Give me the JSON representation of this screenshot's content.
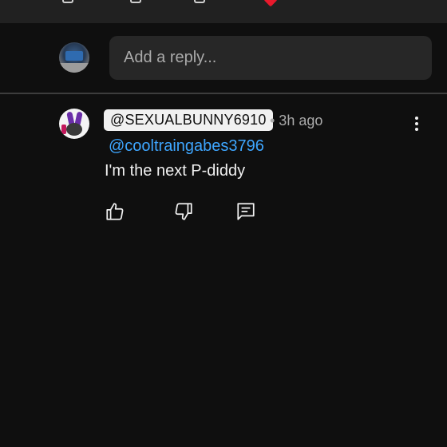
{
  "header": {
    "icons": [
      "thumbs-up-icon",
      "thumbs-down-icon",
      "reply-icon",
      "heart-icon"
    ]
  },
  "reply_box": {
    "placeholder": "Add a reply..."
  },
  "comment": {
    "author": "@SEXUALBUNNY6910",
    "time": "• 3h ago",
    "mention": "@cooltraingabes3796",
    "text": "I'm the next P-diddy",
    "actions": [
      "like",
      "dislike",
      "reply"
    ]
  },
  "colors": {
    "background": "#0f0f0f",
    "input_bg": "#272727",
    "mention": "#3ea6ff",
    "secondary_text": "#aaaaaa",
    "heart": "#e8192c"
  }
}
